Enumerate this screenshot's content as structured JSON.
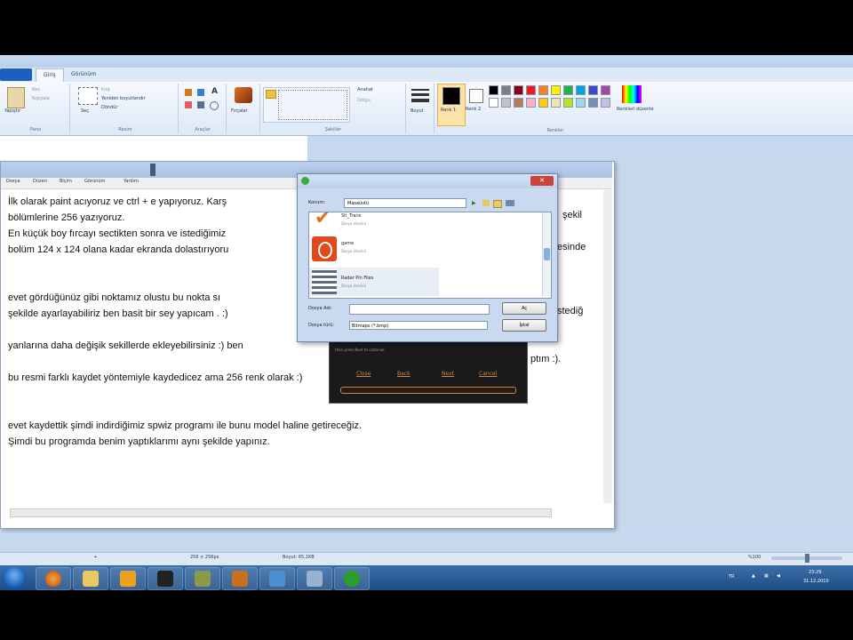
{
  "ribbon": {
    "tabs": [
      "Giriş",
      "Görünüm"
    ],
    "groups": [
      "Pano",
      "Resim",
      "Araçlar",
      "Şekiller",
      "Renkler"
    ],
    "clipboard": {
      "paste": "Yapıştır",
      "cut": "Kes",
      "copy": "Kopyala"
    },
    "image": {
      "select": "Seç",
      "crop": "Kırp",
      "resize": "Yeniden boyutlandır",
      "rotate": "Döndür"
    },
    "brushes": "Fırçalar",
    "outline": "Anahat",
    "fill": "Dolgu",
    "size": "Boyut",
    "color1": "Renk 1",
    "color2": "Renk 2",
    "edit_colors": "Renkleri düzenle"
  },
  "palette": [
    "#000000",
    "#7f7f7f",
    "#880015",
    "#ed1c24",
    "#ff7f27",
    "#fff200",
    "#22b14c",
    "#00a2e8",
    "#3f48cc",
    "#a349a4",
    "#ffffff",
    "#c3c3c3",
    "#b97a57",
    "#ffaec9",
    "#ffc90e",
    "#efe4b0",
    "#b5e61d",
    "#99d9ea",
    "#7092be",
    "#c8bfe7"
  ],
  "notepad": {
    "menu": [
      "Dosya",
      "Düzen",
      "Biçim",
      "Görünüm",
      "Yardım"
    ],
    "lines": [
      "İlk olarak paint acıyoruz ve ctrl + e yapıyoruz. Karş",
      "bölümlerine 256 yazıyoruz.",
      "En küçük boy fırcayı sectikten sonra ve istediğimiz",
      "bolüm 124 x 124 olana kadar ekranda dolastırıyoru",
      "",
      "",
      "evet gördüğünüz gibi noktamız olustu bu nokta sı",
      "şekilde ayarlayabiliriz ben basit bir sey yapıcam . :)",
      "",
      "yanlarına daha değişik sekillerde ekleyebilirsiniz :) ben",
      "",
      "bu resmi farklı kaydet yöntemiyle kaydedicez ama 256 renk olarak :)",
      "",
      "",
      "evet kaydettik şimdi indirdiğimiz spwiz programı ile bunu model haline getireceğiz.",
      "Şimdi bu programda benim yaptıklarımı aynı şekilde yapınız."
    ],
    "fragments": {
      "line1_end": "şekil",
      "line3_end": "esinde",
      "line7_end": "stediğ",
      "line10_end": "ptım :)."
    }
  },
  "dark_window": {
    "text": "then press Next to continue",
    "buttons": [
      "Close",
      "Back",
      "Next",
      "Cancel"
    ]
  },
  "dialog": {
    "location_label": "Konum:",
    "location_value": "Masaüstü",
    "items": [
      {
        "name": "Sti_Trace",
        "sub": "Dosya klasörü"
      },
      {
        "name": "game",
        "sub": "Dosya klasörü"
      },
      {
        "name": "Radar Pin Files",
        "sub": "Dosya klasörü"
      }
    ],
    "name_label": "Dosya Adı:",
    "type_label": "Dosya türü:",
    "type_value": "Bitmaps (*.bmp)",
    "open_btn": "Aç",
    "cancel_btn": "İptal"
  },
  "status": {
    "size_dim": "256 × 256px",
    "file_size": "Boyut: 65,1KB",
    "zoom": "%100"
  },
  "tray": {
    "lang": "TR",
    "time": "23:29",
    "date": "31.12.2010"
  }
}
